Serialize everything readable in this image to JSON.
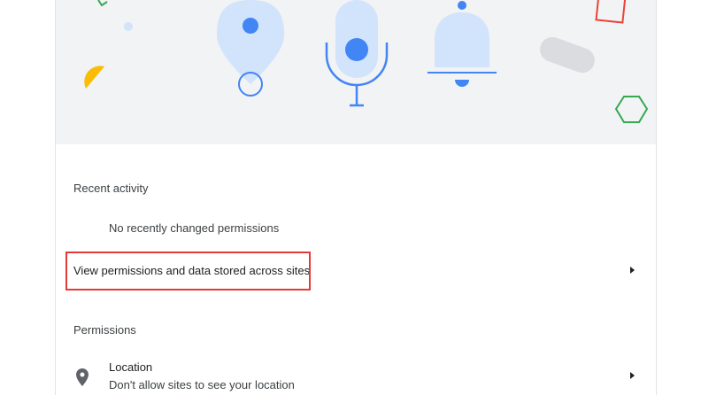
{
  "recent_activity": {
    "heading": "Recent activity",
    "empty_message": "No recently changed permissions"
  },
  "view_permissions_row": {
    "label": "View permissions and data stored across sites"
  },
  "permissions": {
    "heading": "Permissions",
    "location": {
      "title": "Location",
      "subtitle": "Don't allow sites to see your location"
    }
  },
  "icons": {
    "banner": [
      "location-pin-illustration",
      "microphone-illustration",
      "notification-bell-illustration"
    ],
    "row_arrow": "arrow-right-icon",
    "location": "location-pin-icon"
  },
  "colors": {
    "accent_blue": "#4285f4",
    "light_blue": "#d2e3fc",
    "banner_bg": "#f1f3f4",
    "highlight": "#e53935",
    "yellow": "#fbbc04",
    "green": "#34a853",
    "red": "#ea4335"
  }
}
